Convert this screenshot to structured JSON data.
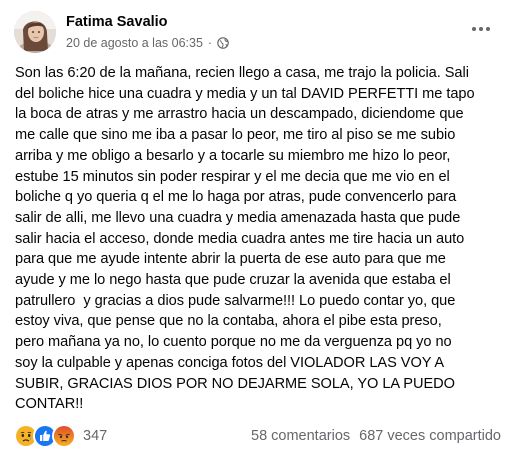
{
  "post": {
    "author": "Fatima Savalio",
    "timestamp": "20 de agosto a las 06:35",
    "separator": "·",
    "audience_icon": "globe-icon",
    "menu_icon": "more-options-icon",
    "text": "Son las 6:20 de la mañana, recien llego a casa, me trajo la policia. Sali\ndel boliche hice una cuadra y media y un tal DAVID PERFETTI me tapo\nla boca de atras y me arrastro hacia un descampado, diciendome que\nme calle que sino me iba a pasar lo peor, me tiro al piso se me subio\narriba y me obligo a besarlo y a tocarle su miembro me hizo lo peor,\nestube 15 minutos sin poder respirar y el me decia que me vio en el\nboliche q yo queria q el me lo haga por atras, pude convencerlo para\nsalir de alli, me llevo una cuadra y media amenazada hasta que pude\nsalir hacia el acceso, donde media cuadra antes me tire hacia un auto\npara que me ayude intente abrir la puerta de ese auto para que me\nayude y me lo nego hasta que pude cruzar la avenida que estaba el\npatrullero  y gracias a dios pude salvarme!!! Lo puedo contar yo, que\nestoy viva, que pense que no la contaba, ahora el pibe esta preso,\npero mañana ya no, lo cuento porque no me da verguenza pq yo no\nsoy la culpable y apenas conciga fotos del VIOLADOR LAS VOY A\nSUBIR, GRACIAS DIOS POR NO DEJARME SOLA, YO LA PUEDO\nCONTAR!!"
  },
  "footer": {
    "reactions": [
      "sad-reaction-icon",
      "like-reaction-icon",
      "angry-reaction-icon"
    ],
    "reaction_count": "347",
    "comments": "58 comentarios",
    "shares": "687 veces compartido"
  },
  "colors": {
    "text": "#050505",
    "secondary": "#65676b",
    "like_blue": "#1877f2",
    "sad_yellow": "#f7b125",
    "angry_red": "#e9710f"
  }
}
